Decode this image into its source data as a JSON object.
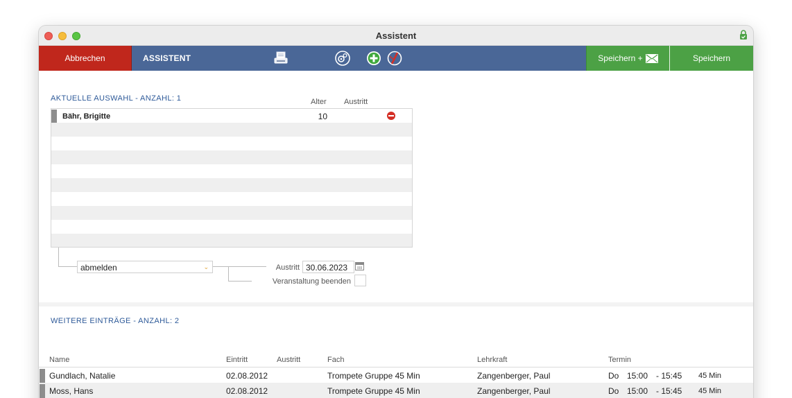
{
  "window": {
    "title": "Assistent"
  },
  "toolbar": {
    "cancel_label": "Abbrechen",
    "title_label": "ASSISTENT",
    "save_mail_label": "Speichern +",
    "save_label": "Speichern",
    "icons": [
      "printer-icon",
      "settings-gear-icon",
      "add-icon",
      "delete-icon",
      "mail-icon"
    ]
  },
  "selection": {
    "title": "AKTUELLE AUSWAHL - ANZAHL: 1",
    "columns": {
      "age": "Alter",
      "exit": "Austritt"
    },
    "rows": [
      {
        "name": "Bähr, Brigitte",
        "age": "10",
        "exit": ""
      }
    ],
    "action_select": {
      "value": "abmelden"
    },
    "exit_label": "Austritt",
    "exit_date": "30.06.2023",
    "end_event_label": "Veranstaltung beenden",
    "end_event_checked": false
  },
  "more_entries": {
    "title": "WEITERE EINTRÄGE - ANZAHL: 2",
    "columns": {
      "name": "Name",
      "entry": "Eintritt",
      "exit": "Austritt",
      "subject": "Fach",
      "teacher": "Lehrkraft",
      "appointment": "Termin"
    },
    "rows": [
      {
        "name": "Gundlach, Natalie",
        "entry": "02.08.2012",
        "exit": "",
        "subject": "Trompete Gruppe 45 Min",
        "teacher": "Zangenberger, Paul",
        "day": "Do",
        "start": "15:00",
        "end": "- 15:45",
        "duration": "45 Min"
      },
      {
        "name": "Moss, Hans",
        "entry": "02.08.2012",
        "exit": "",
        "subject": "Trompete Gruppe 45 Min",
        "teacher": "Zangenberger, Paul",
        "day": "Do",
        "start": "15:00",
        "end": "- 15:45",
        "duration": "45 Min"
      }
    ]
  },
  "colors": {
    "toolbar_bg": "#4a6797",
    "cancel_bg": "#c0271c",
    "save_bg": "#4ca145",
    "section_title": "#2e5a99"
  }
}
